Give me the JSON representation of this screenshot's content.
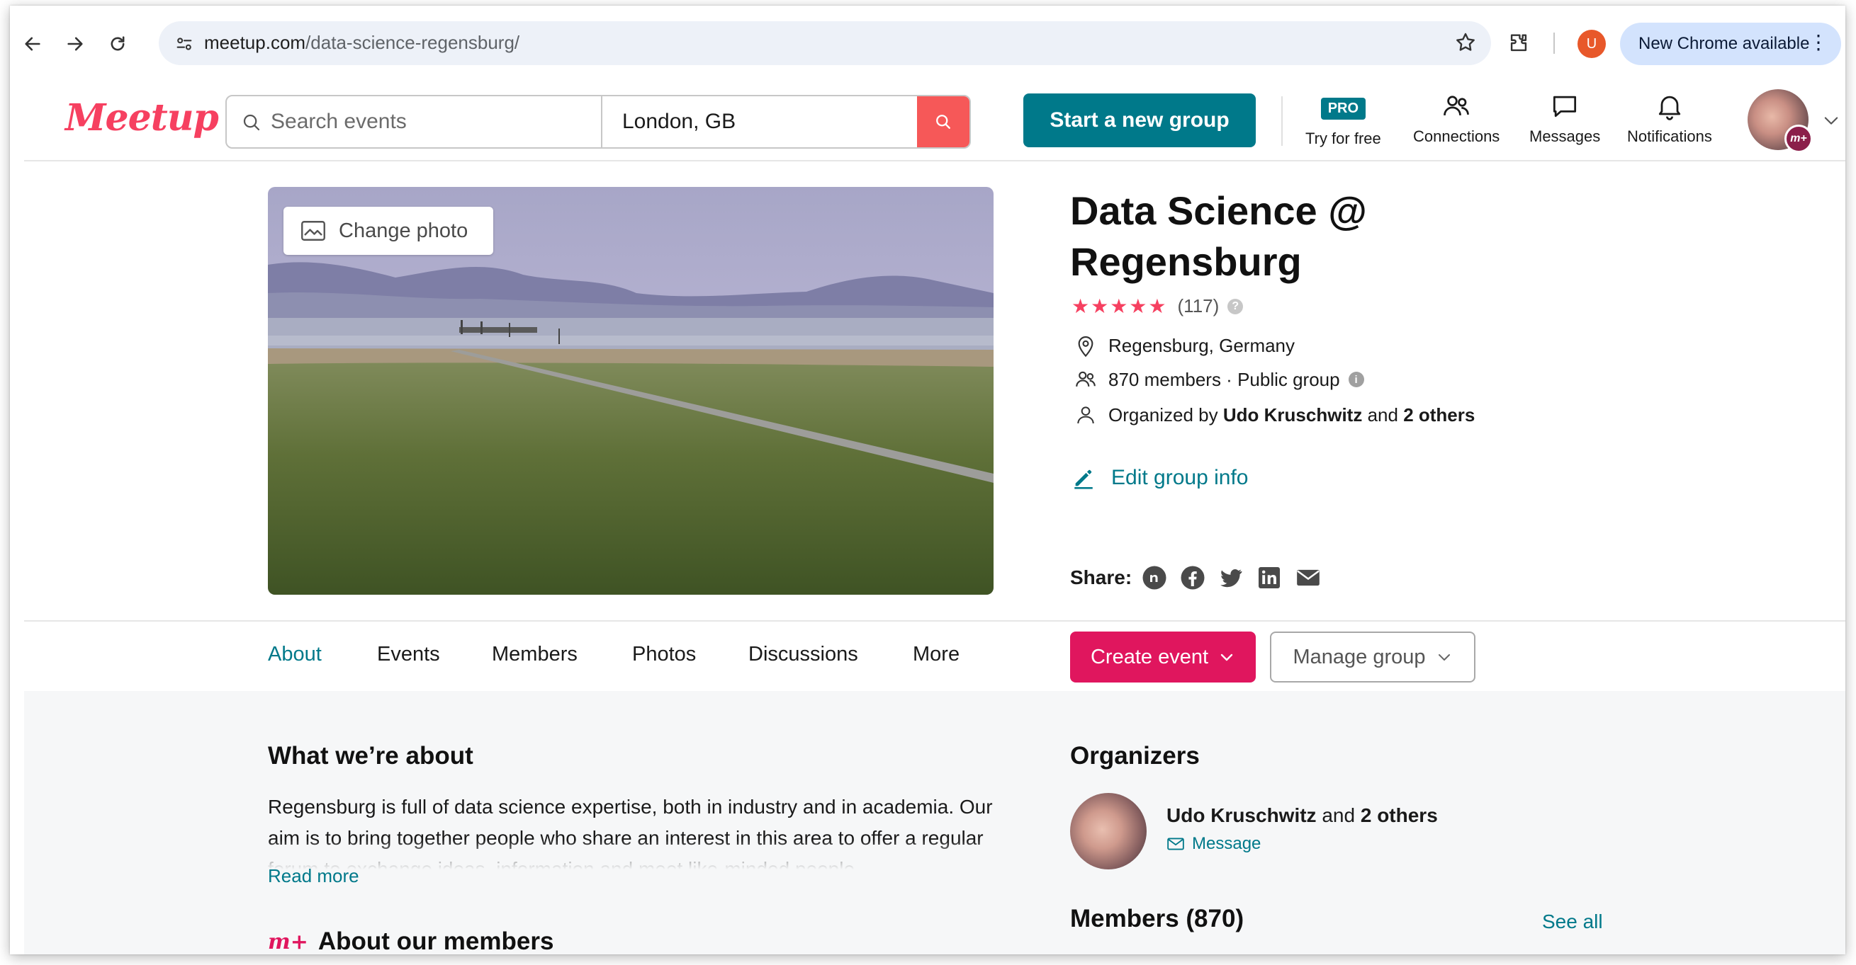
{
  "browser": {
    "url_host": "meetup.com",
    "url_path": "/data-science-regensburg/",
    "profile_initial": "U",
    "update_label": "New Chrome available",
    "menu_dots": "⋮"
  },
  "header": {
    "logo_text": "Meetup",
    "search_placeholder": "Search events",
    "location_value": "London, GB",
    "start_group_label": "Start a new group",
    "pro_badge": "PRO",
    "try_free_label": "Try for free",
    "connections_label": "Connections",
    "messages_label": "Messages",
    "notifications_label": "Notifications"
  },
  "group": {
    "change_photo_label": "Change photo",
    "title_line1": "Data Science @",
    "title_line2": "Regensburg",
    "stars": "★★★★★",
    "rating_count": "(117)",
    "help_mark": "?",
    "location": "Regensburg, Germany",
    "members_summary": "870 members · Public group",
    "info_mark": "i",
    "organized_prefix": "Organized by",
    "organizer_name": "Udo Kruschwitz",
    "organized_and": "and",
    "organized_others": "2 others",
    "edit_label": "Edit group info",
    "share_label": "Share:"
  },
  "tabs": {
    "about": "About",
    "events": "Events",
    "members": "Members",
    "photos": "Photos",
    "discussions": "Discussions",
    "more": "More",
    "create_event": "Create event",
    "manage_group": "Manage group"
  },
  "about": {
    "title": "What we’re about",
    "text": "Regensburg is full of data science expertise, both in industry and in academia. Our aim is to bring together people who share an interest in this area to offer a regular forum to exchange ideas, information and meet like-minded people.",
    "read_more": "Read more",
    "members_logo": "m+",
    "members_title": "About our members"
  },
  "organizers": {
    "title": "Organizers",
    "name": "Udo Kruschwitz",
    "and": "and",
    "others": "2 others",
    "message_label": "Message"
  },
  "members_section": {
    "title": "Members (870)",
    "see_all": "See all"
  },
  "colors": {
    "brand_teal": "#00798a",
    "meetup_red": "#f64060",
    "create_pink": "#e0165e"
  }
}
